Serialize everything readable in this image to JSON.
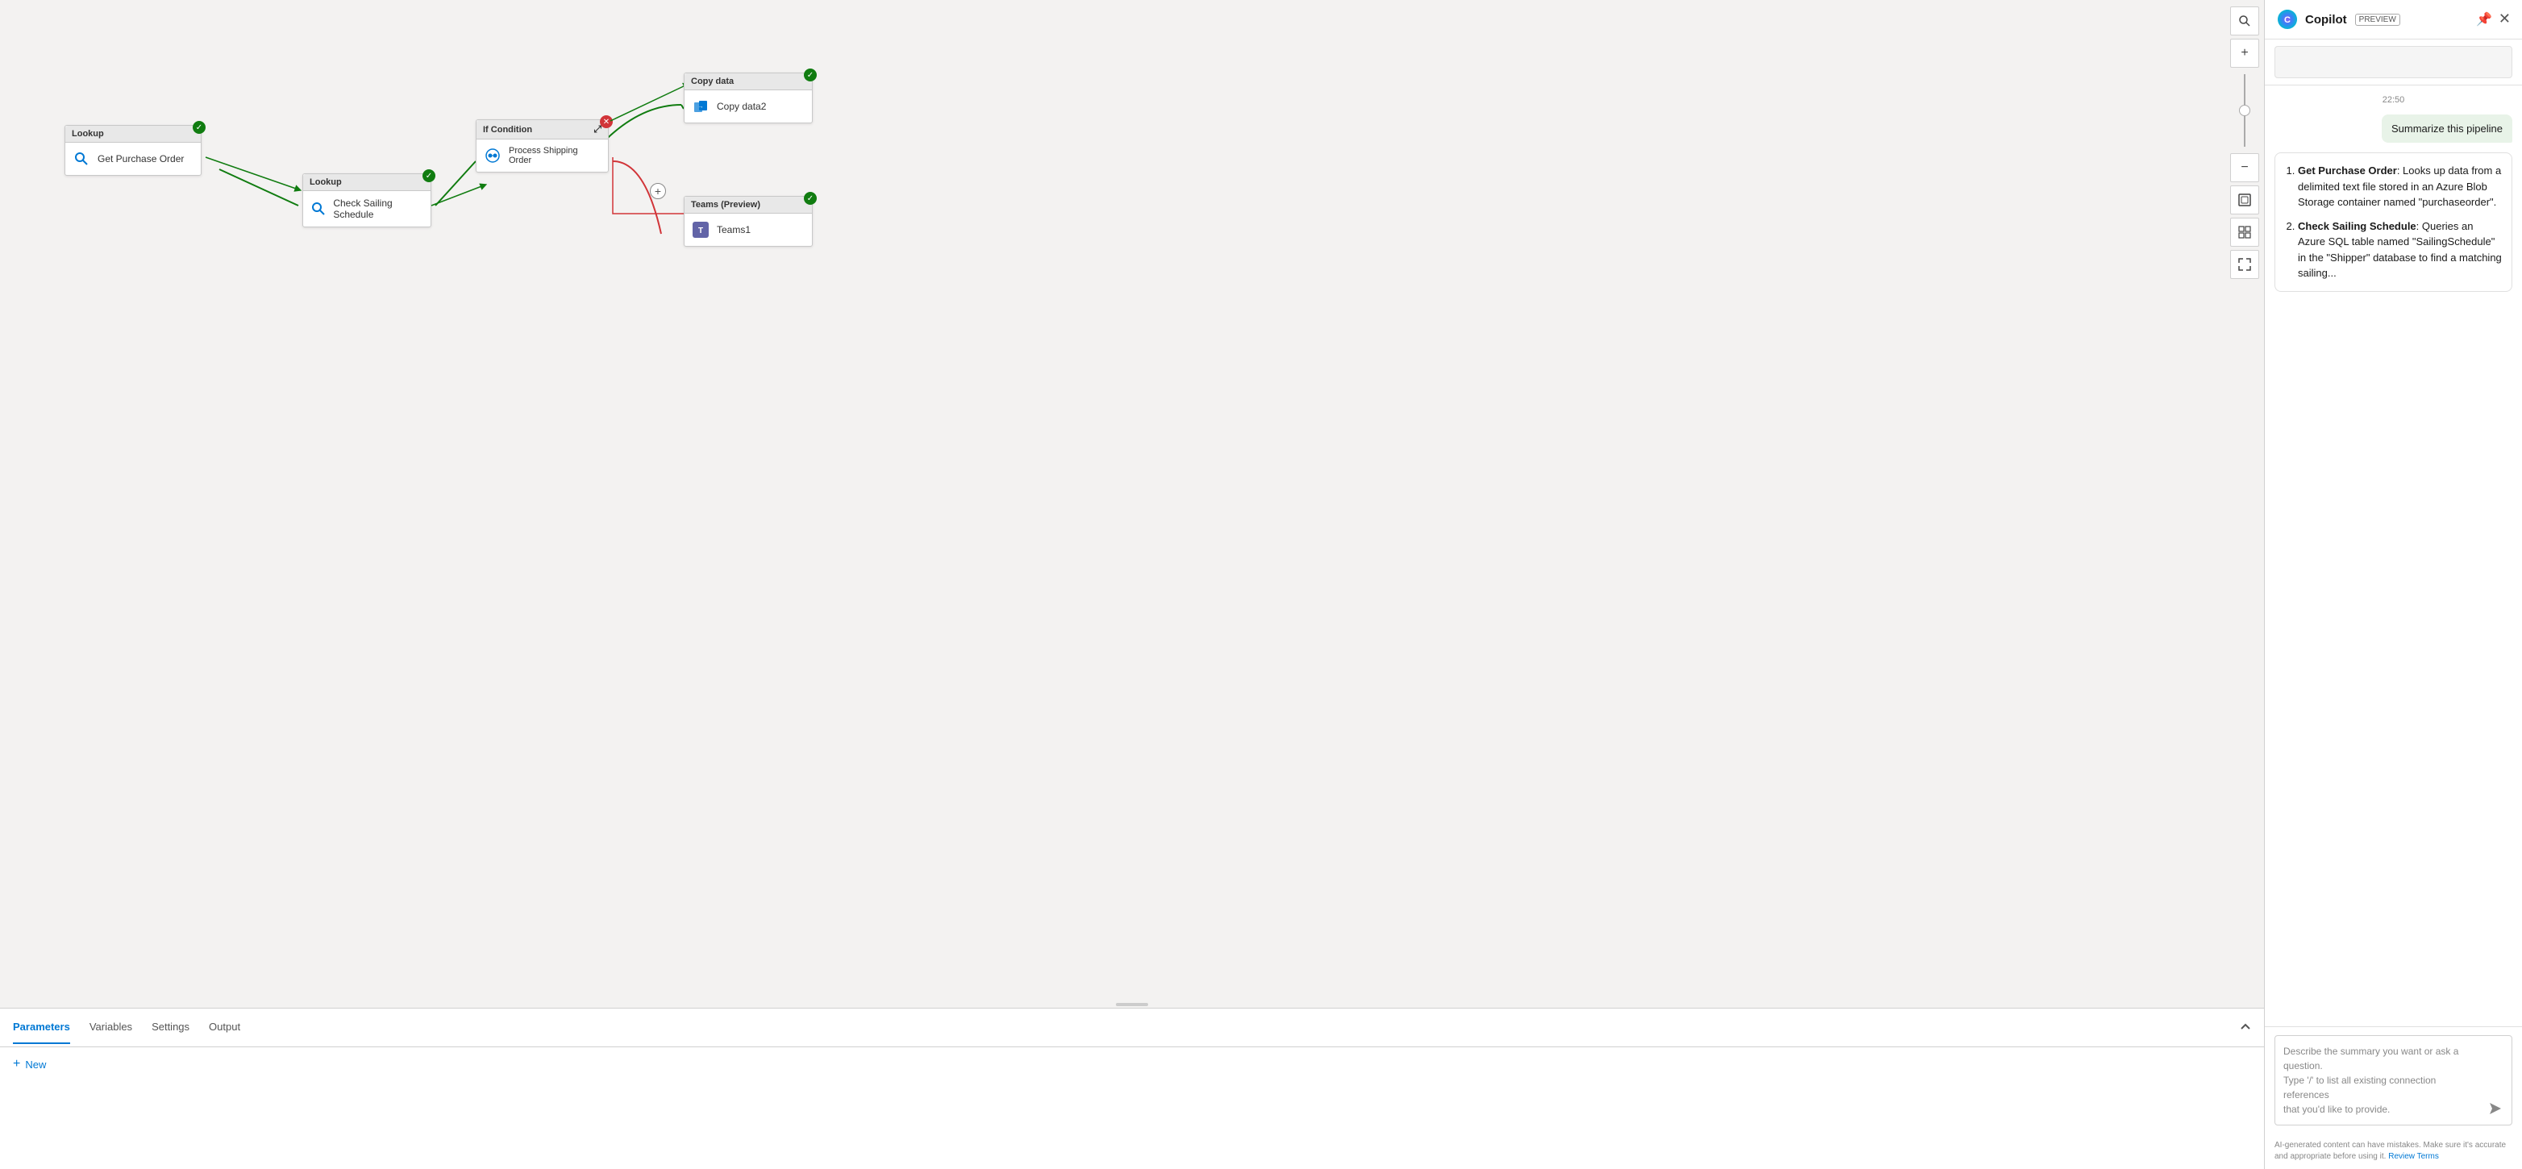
{
  "copilot": {
    "title": "Copilot",
    "preview": "PREVIEW",
    "timestamp": "22:50",
    "user_message": "Summarize this pipeline",
    "bot_message_1": {
      "item1_title": "Get Purchase Order",
      "item1_text": ": Looks up data from a delimited text file stored in an Azure Blob Storage container named \"purchaseorder\".",
      "item2_title": "Check Sailing Schedule",
      "item2_text": ": Queries an Azure SQL table named \"SailingSchedule\" in the \"Shipper\" database to find a matching sailing..."
    },
    "input_placeholder_line1": "Describe the summary you want or ask a question.",
    "input_placeholder_line2": "Type '/' to list all existing connection references",
    "input_placeholder_line3": "that you'd like to provide.",
    "footer_text": "AI-generated content can have mistakes. Make sure it's accurate and appropriate before using it. ",
    "footer_link": "Review Terms"
  },
  "nodes": {
    "lookup1": {
      "header": "Lookup",
      "label": "Get Purchase Order"
    },
    "lookup2": {
      "header": "Lookup",
      "label": "Check Sailing Schedule"
    },
    "ifcondition": {
      "header": "If Condition"
    },
    "process": {
      "label1": "Process Shipping",
      "label2": "Order"
    },
    "copydata": {
      "header": "Copy data",
      "label": "Copy data2"
    },
    "teams": {
      "header": "Teams (Preview)",
      "label": "Teams1"
    }
  },
  "bottom_panel": {
    "tabs": [
      {
        "label": "Parameters",
        "active": true
      },
      {
        "label": "Variables",
        "active": false
      },
      {
        "label": "Settings",
        "active": false
      },
      {
        "label": "Output",
        "active": false
      }
    ],
    "new_button": "New"
  },
  "toolbar": {
    "search_icon": "🔍",
    "zoom_in": "+",
    "zoom_out": "−",
    "fit_icon": "⊡",
    "grid_icon": "⊞",
    "expand_icon": "⤢"
  }
}
